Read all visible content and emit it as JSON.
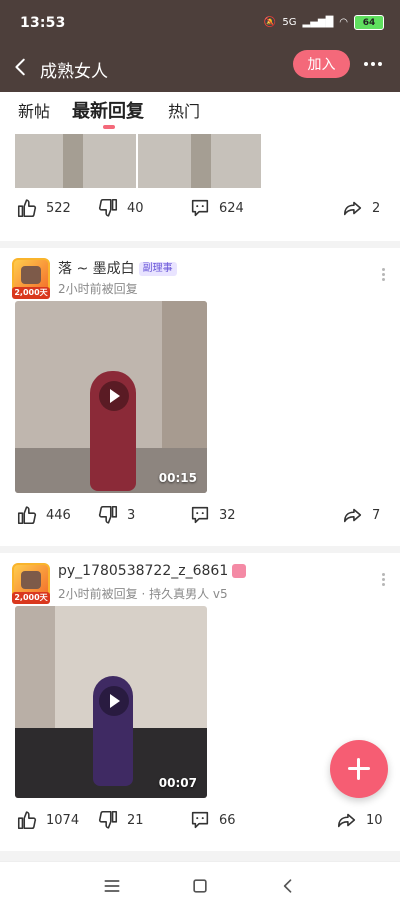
{
  "status": {
    "time": "13:53",
    "network": "5G",
    "battery": "64",
    "notification_icon": "bell-muted-icon"
  },
  "topbar": {
    "title": "成熟女人",
    "join_label": "加入",
    "back_icon": "chevron-left-icon",
    "more_icon": "more-horizontal-icon"
  },
  "tabs": [
    "新帖",
    "最新回复",
    "热门"
  ],
  "feed": {
    "card1": {
      "likes": "522",
      "dislikes": "40",
      "comments": "624",
      "shares": "2"
    },
    "card2": {
      "name": "落 ~ 墨成白",
      "role": "副理事",
      "time": "2小时前被回复",
      "avatar_badge": "2,000天",
      "duration": "00:15",
      "likes": "446",
      "dislikes": "3",
      "comments": "32",
      "shares": "7"
    },
    "card3": {
      "name": "py_1780538722_z_6861",
      "time": "2小时前被回复",
      "extra": "持久真男人 v5",
      "avatar_badge": "2,000天",
      "duration": "00:07",
      "likes": "1074",
      "dislikes": "21",
      "comments": "66",
      "shares": "10"
    }
  },
  "fab": {
    "icon": "plus-icon"
  },
  "navbar": {
    "menu_icon": "menu-icon",
    "home_icon": "home-square-icon",
    "back_icon": "back-triangle-icon"
  },
  "colors": {
    "accent": "#f4697a",
    "header": "#4d3f3b"
  }
}
